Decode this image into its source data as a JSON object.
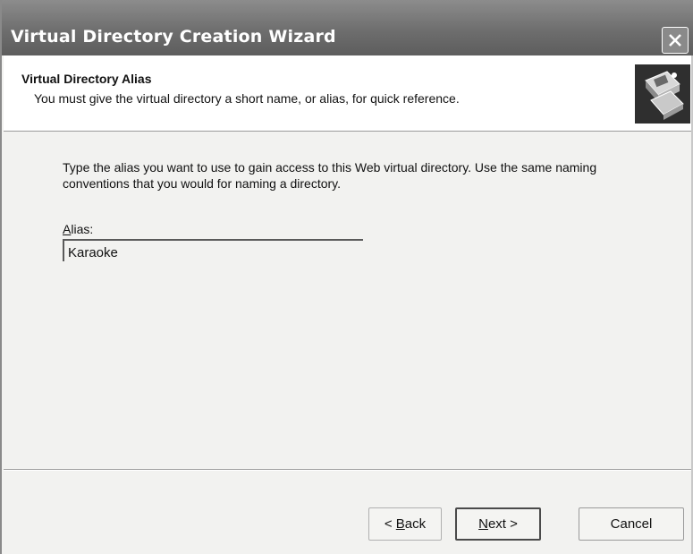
{
  "window": {
    "title": "Virtual Directory Creation Wizard",
    "close_icon": "close-icon"
  },
  "header": {
    "title": "Virtual Directory Alias",
    "subtitle": "You must give the virtual directory a short name, or alias, for quick reference.",
    "icon": "wizard-book-icon"
  },
  "body": {
    "instructions": "Type the alias you want to use to gain access to this Web virtual directory. Use the same naming conventions that you would for naming a directory.",
    "alias_label_hotkey": "A",
    "alias_label_rest": "lias:",
    "alias_value": "Karaoke"
  },
  "buttons": {
    "back_prefix": "< ",
    "back_hotkey": "B",
    "back_rest": "ack",
    "next_hotkey": "N",
    "next_rest": "ext >",
    "cancel": "Cancel"
  }
}
